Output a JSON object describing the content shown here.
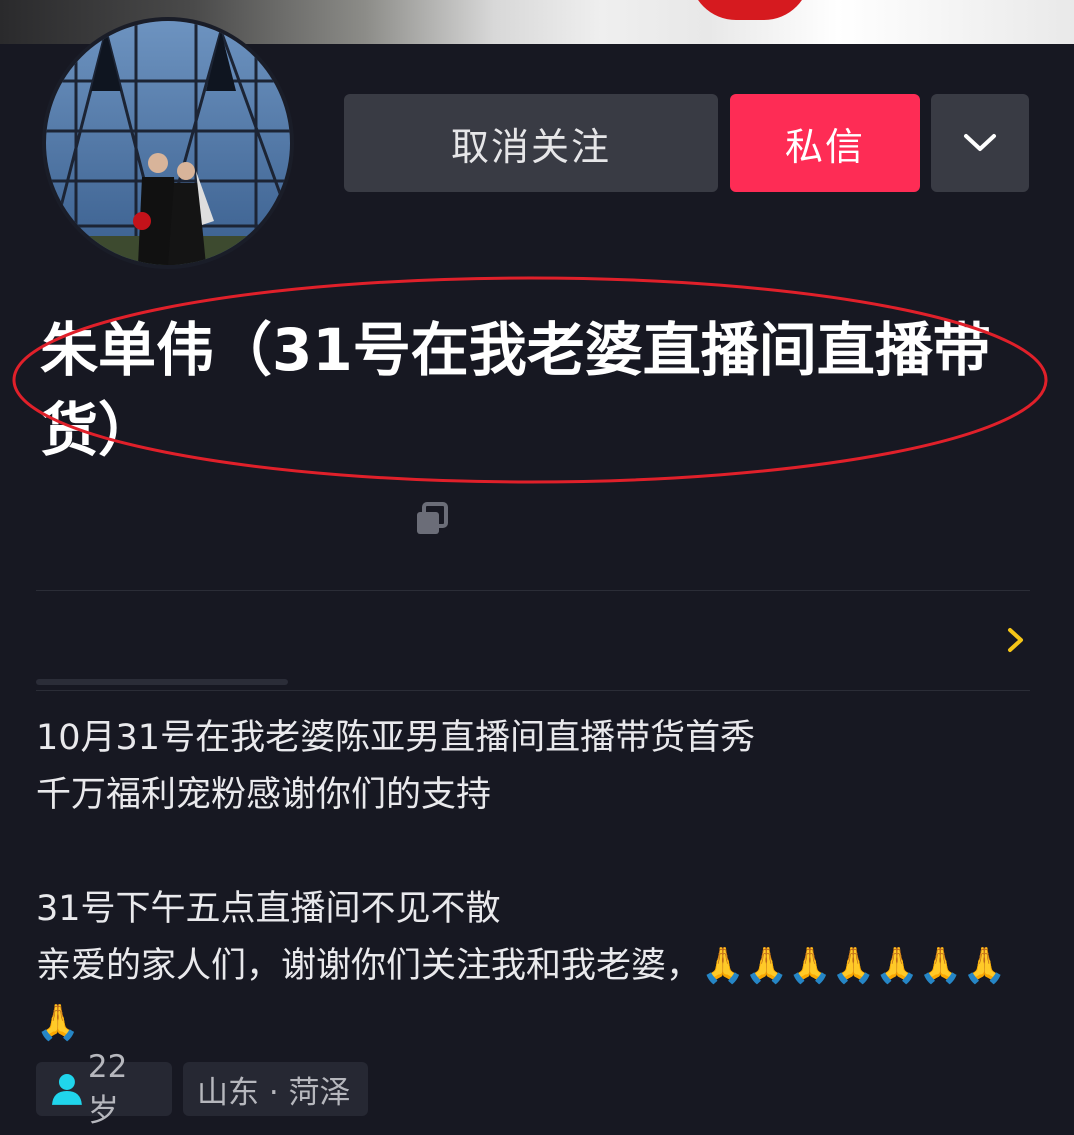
{
  "actions": {
    "unfollow_label": "取消关注",
    "message_label": "私信",
    "more_icon": "chevron-down-icon"
  },
  "profile": {
    "name": "朱单伟（31号在我老婆直播间直播带货）",
    "bio": "10月31号在我老婆陈亚男直播间直播带货首秀\n千万福利宠粉感谢你们的支持\n\n31号下午五点直播间不见不散\n亲爱的家人们，谢谢你们关注我和我老婆，🙏🙏🙏🙏🙏🙏🙏🙏",
    "age": "22岁",
    "location": "山东 · 菏泽"
  },
  "colors": {
    "background": "#161823",
    "message_button": "#fe2c55",
    "secondary_button": "#393b44",
    "annotation_oval": "#e0202a",
    "chevron_accent": "#f5c518",
    "age_icon": "#20d5ec"
  }
}
